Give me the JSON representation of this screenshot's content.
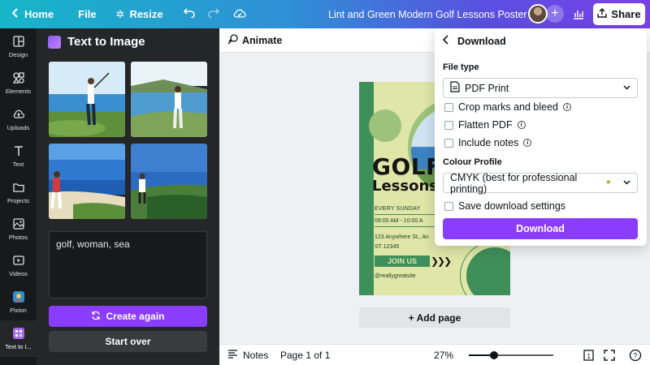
{
  "topbar": {
    "home_label": "Home",
    "file_label": "File",
    "resize_label": "Resize",
    "doc_title": "Lint and Green Modern Golf Lessons Poster",
    "share_label": "Share"
  },
  "rail": {
    "items": [
      {
        "label": "Design",
        "icon": "layout-icon"
      },
      {
        "label": "Elements",
        "icon": "shapes-icon"
      },
      {
        "label": "Uploads",
        "icon": "cloud-upload-icon"
      },
      {
        "label": "Text",
        "icon": "text-t-icon"
      },
      {
        "label": "Projects",
        "icon": "folder-icon"
      },
      {
        "label": "Photos",
        "icon": "image-icon"
      },
      {
        "label": "Videos",
        "icon": "video-icon"
      },
      {
        "label": "Pixton",
        "icon": "pixton-app-icon"
      },
      {
        "label": "Text to I...",
        "icon": "text-to-image-icon"
      }
    ]
  },
  "panel": {
    "title": "Text to Image",
    "prompt_value": "golf, woman, sea",
    "create_again_label": "Create again",
    "start_over_label": "Start over"
  },
  "subbar": {
    "animate_label": "Animate"
  },
  "poster": {
    "title_big": "GOLF",
    "title_small": "Lessons",
    "line1": "EVERY SUNDAY",
    "line2": "09:00 AM - 10:00 A",
    "line3": "123 Anywhere St., An",
    "line4": "ST 12345",
    "join_label": "JOIN US",
    "handle": "@reallygreatsite"
  },
  "canvas": {
    "add_page_label": "+ Add page"
  },
  "footer": {
    "notes_label": "Notes",
    "page_info": "Page 1 of 1",
    "zoom": "27%",
    "zoom_slider_fraction": 0.3
  },
  "download": {
    "title": "Download",
    "file_type_label": "File type",
    "file_type_value": "PDF Print",
    "options": [
      {
        "label": "Crop marks and bleed",
        "checked": false
      },
      {
        "label": "Flatten PDF",
        "checked": false
      },
      {
        "label": "Include notes",
        "checked": false
      }
    ],
    "colour_profile_label": "Colour Profile",
    "colour_profile_value": "CMYK (best for professional printing)",
    "save_settings_label": "Save download settings",
    "download_button_label": "Download"
  },
  "colors": {
    "accent_purple": "#8b3dff",
    "rail_bg": "#18191b",
    "panel_bg": "#252627",
    "poster_bg": "#dfe6a8",
    "poster_green": "#3f8f5a"
  }
}
